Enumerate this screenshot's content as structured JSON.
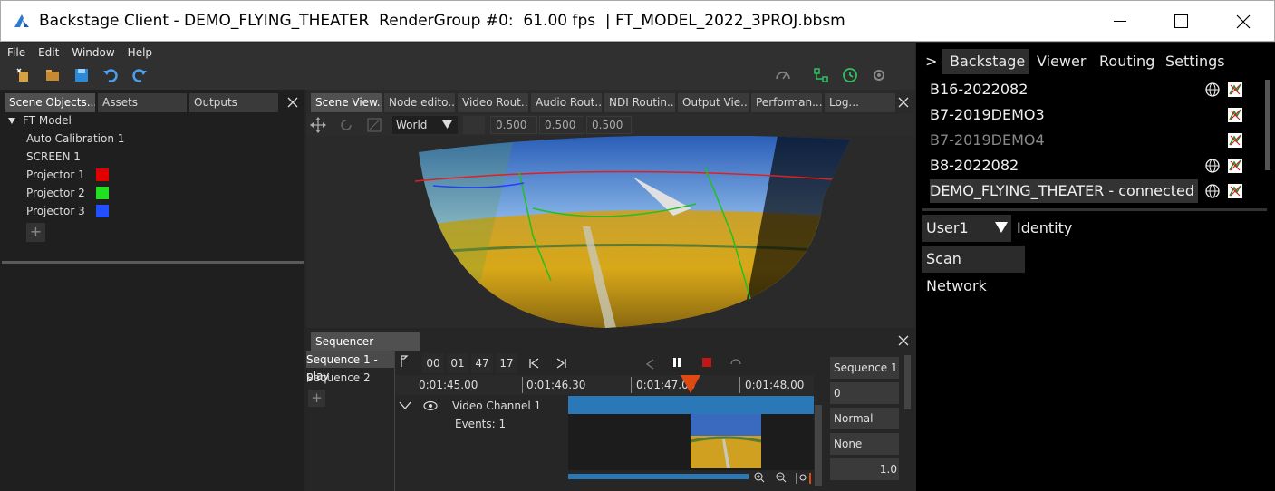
{
  "window": {
    "title": "Backstage Client - DEMO_FLYING_THEATER  RenderGroup #0:  61.00 fps  | FT_MODEL_2022_3PROJ.bbsm",
    "minimize": "—",
    "maximize": "☐",
    "close": "✕"
  },
  "menu": {
    "file": "File",
    "edit": "Edit",
    "window": "Window",
    "help": "Help"
  },
  "left_tabs": {
    "scene_objects": "Scene Objects...",
    "assets": "Assets",
    "outputs": "Outputs"
  },
  "tree": {
    "root": "FT Model",
    "items": [
      {
        "label": "Auto Calibration 1"
      },
      {
        "label": "SCREEN 1"
      },
      {
        "label": "Projector 1",
        "color": "#e00000"
      },
      {
        "label": "Projector 2",
        "color": "#20e020"
      },
      {
        "label": "Projector 3",
        "color": "#2050ff"
      }
    ],
    "add": "+"
  },
  "view_tabs": {
    "scene_view": "Scene View...",
    "node_editor": "Node edito...",
    "video_routing": "Video Rout...",
    "audio_routing": "Audio Rout...",
    "ndi_routing": "NDI Routin...",
    "output_viewer": "Output Vie...",
    "performance": "Performan...",
    "log": "Log..."
  },
  "viewport_toolbar": {
    "space": "World",
    "scale_x": "0.500",
    "scale_y": "0.500",
    "scale_z": "0.500"
  },
  "sequencer": {
    "tab": "Sequencer",
    "sequences": [
      "Sequence 1 - play",
      "Sequence 2"
    ],
    "add": "+",
    "timecode": {
      "h": "00",
      "m": "01",
      "s": "47",
      "f": "17"
    },
    "ruler": [
      "0:01:45.00",
      "0:01:46.30",
      "0:01:47.00",
      "0:01:48.00"
    ],
    "channel": "Video Channel 1",
    "events": "Events: 1",
    "props": [
      "Sequence 1",
      "0",
      "Normal",
      "None",
      "1.0"
    ]
  },
  "right_panel": {
    "tabs": {
      "expand": ">",
      "backstage": "Backstage",
      "viewer": "Viewer",
      "routing": "Routing",
      "settings": "Settings"
    },
    "devices": [
      {
        "name": "B16-2022082",
        "globe": true
      },
      {
        "name": "B7-2019DEMO3",
        "globe": false
      },
      {
        "name": "B7-2019DEMO4",
        "globe": false,
        "dim": true
      },
      {
        "name": "B8-2022082",
        "globe": true
      },
      {
        "name": "DEMO_FLYING_THEATER - connected",
        "globe": true,
        "selected": true
      }
    ],
    "user": "User1",
    "identity": "Identity",
    "scan": "Scan Network"
  },
  "colors": {
    "accent_blue": "#2a78b8",
    "playhead": "#e04a10",
    "record": "#c01818",
    "status_green": "#30c060"
  }
}
